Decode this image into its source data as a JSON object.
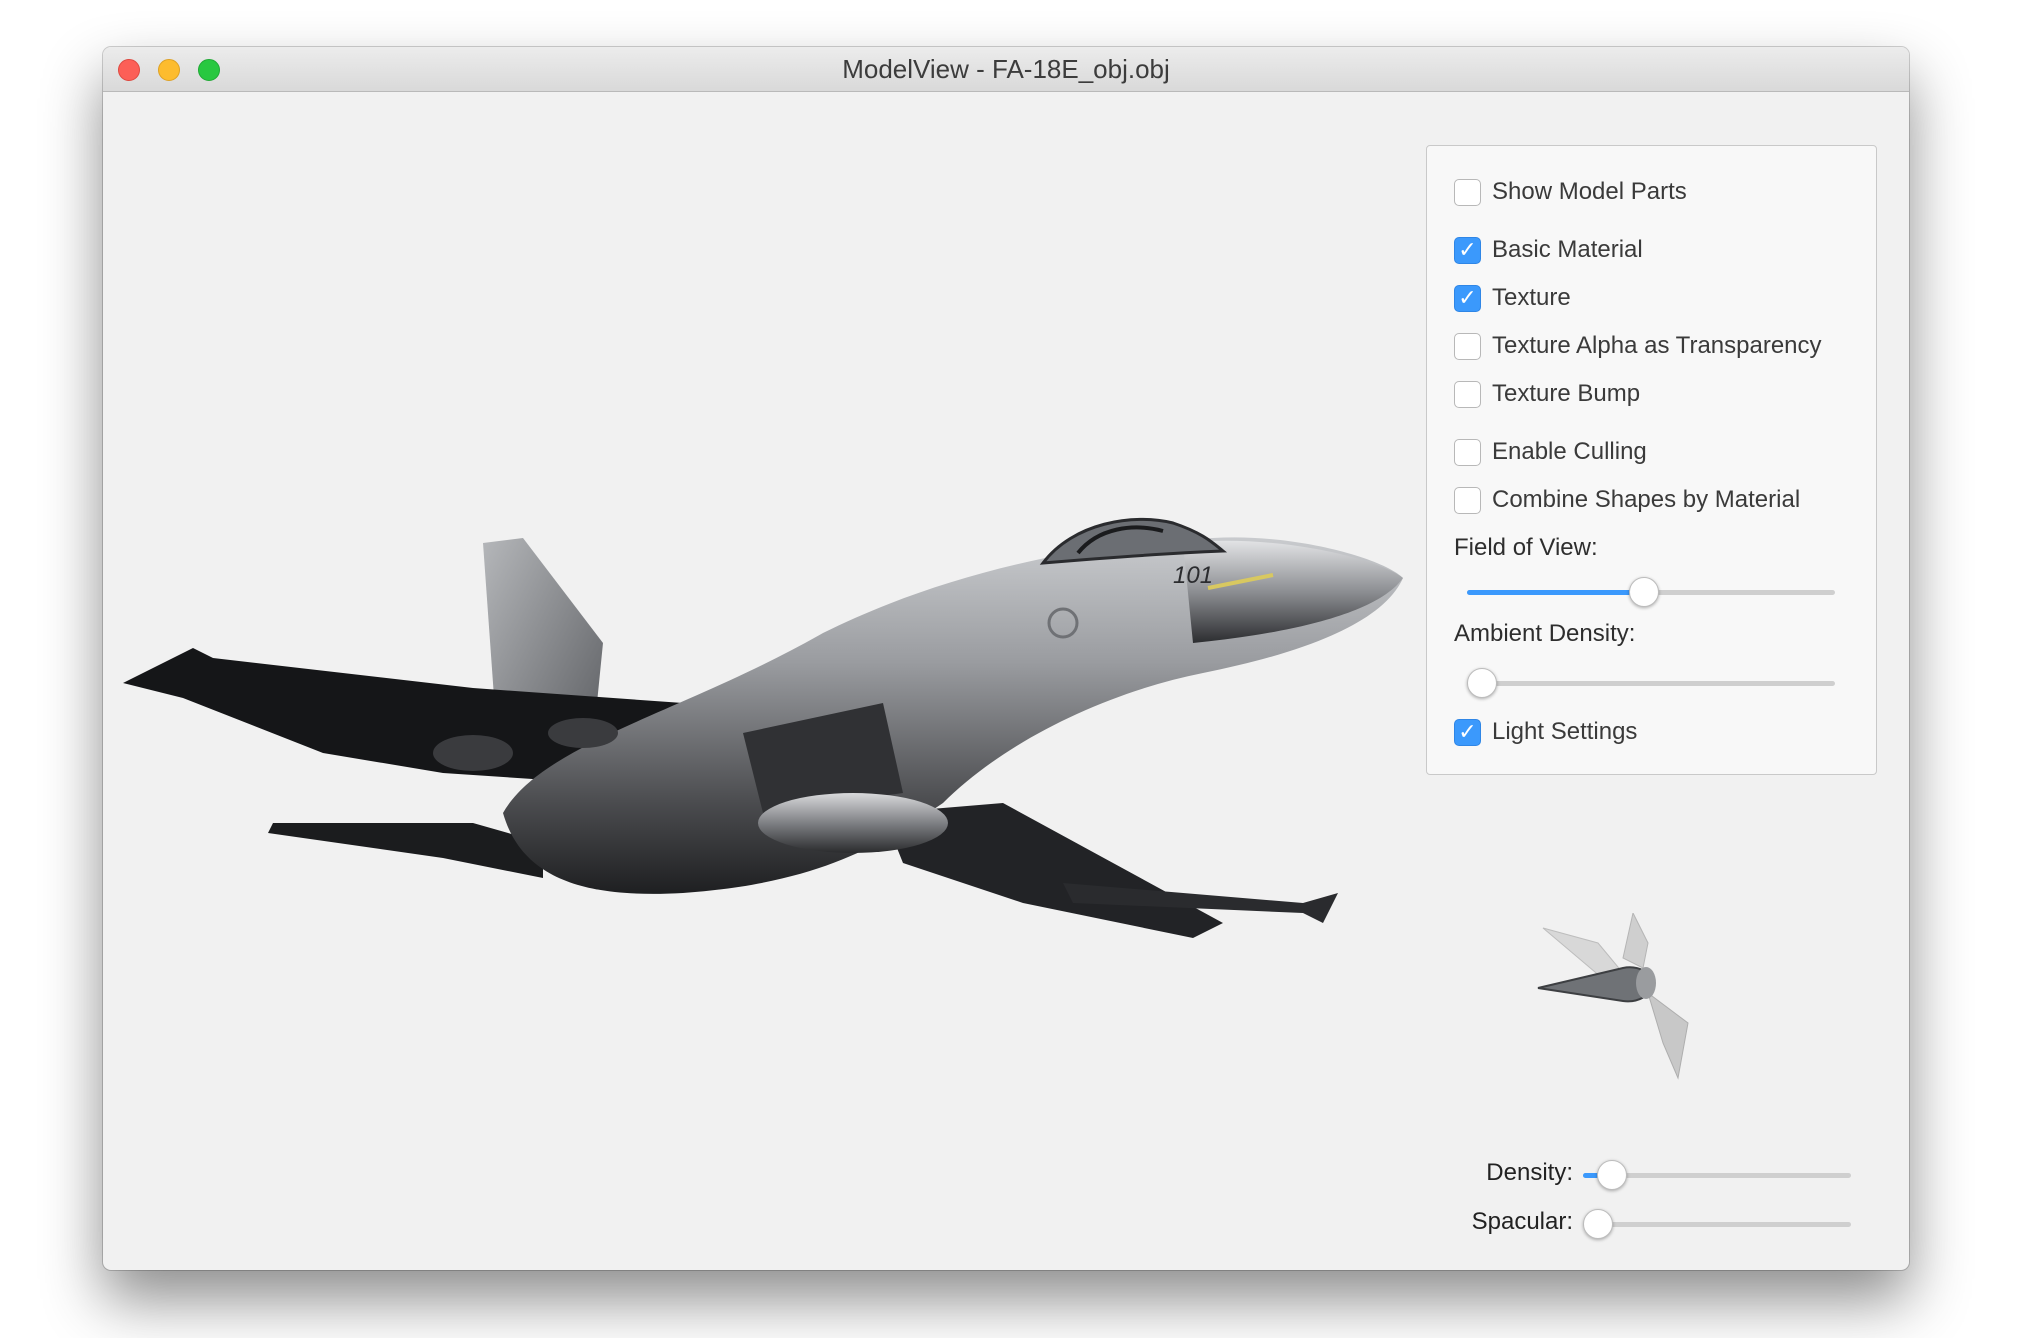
{
  "window": {
    "title": "ModelView - FA-18E_obj.obj"
  },
  "viewport": {
    "model_icon": "fighter-jet-model",
    "gizmo_icon": "light-direction-gizmo"
  },
  "panel": {
    "checkboxes": [
      {
        "label": "Show Model Parts",
        "checked": false
      },
      {
        "label": "Basic Material",
        "checked": true
      },
      {
        "label": "Texture",
        "checked": true
      },
      {
        "label": "Texture Alpha as Transparency",
        "checked": false
      },
      {
        "label": "Texture Bump",
        "checked": false
      },
      {
        "label": "Enable Culling",
        "checked": false
      },
      {
        "label": "Combine Shapes by Material",
        "checked": false
      },
      {
        "label": "Light Settings",
        "checked": true
      }
    ],
    "field_of_view": {
      "label": "Field of View:",
      "value": 0.48
    },
    "ambient_density": {
      "label": "Ambient Density:",
      "value": 0.0
    }
  },
  "light_controls": {
    "density": {
      "label": "Density:",
      "value": 0.06
    },
    "specular": {
      "label": "Spacular:",
      "value": 0.0
    }
  },
  "colors": {
    "accent": "#3b99fc",
    "window_bg": "#f1f1f1"
  }
}
